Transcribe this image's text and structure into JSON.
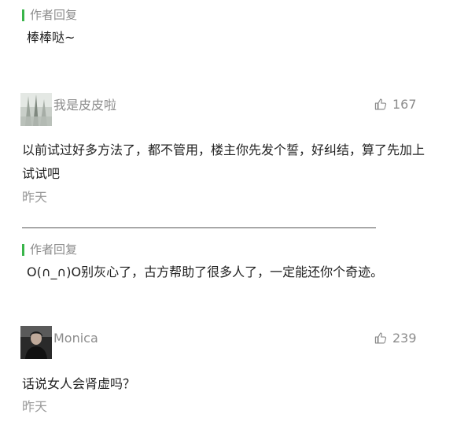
{
  "thread": {
    "top_reply": {
      "label": "作者回复",
      "text": "棒棒哒~"
    },
    "comment_1": {
      "username": "我是皮皮啦",
      "likes": "167",
      "text": "以前试过好多方法了，都不管用，楼主你先发个誓，好纠结，算了先加上试试吧",
      "time": "昨天",
      "reply": {
        "label": "作者回复",
        "text": "O(∩_∩)O别灰心了，古方帮助了很多人了，一定能还你个奇迹。"
      }
    },
    "comment_2": {
      "username": "Monica",
      "likes": "239",
      "text": "话说女人会肾虚吗？",
      "time": "昨天"
    }
  },
  "colors": {
    "reply_bar": "#39b54a",
    "muted_text": "#8c8c8c",
    "body_text": "#222222"
  },
  "icons": {
    "like": "thumbs-up-icon"
  }
}
